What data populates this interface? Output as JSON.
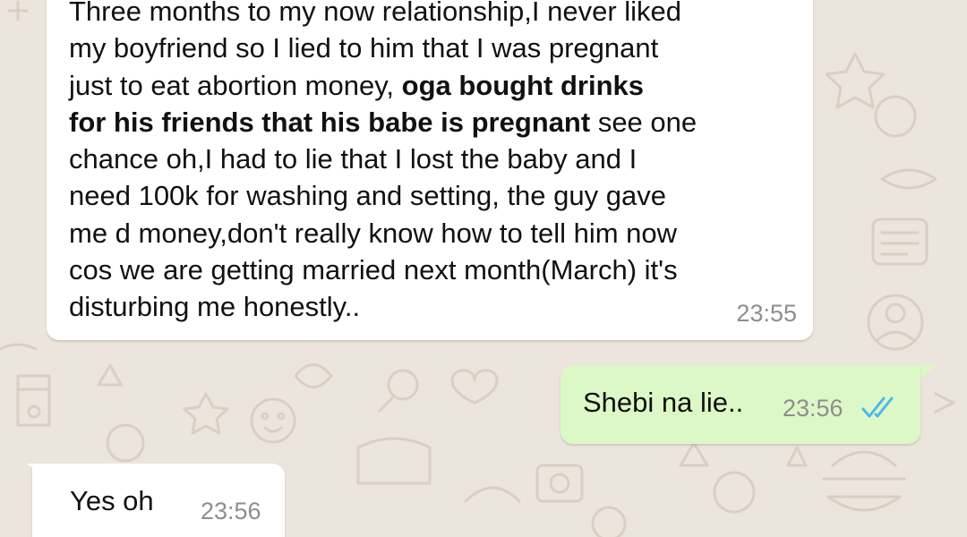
{
  "colors": {
    "wallpaper": "#ece5dd",
    "incoming_bubble": "#ffffff",
    "outgoing_bubble": "#dcf8c6",
    "timestamp": "#8e8e8e",
    "read_ticks": "#4fb6ec"
  },
  "messages": [
    {
      "direction": "incoming",
      "lines": [
        {
          "text": "Three months to my now relationship,I never liked"
        },
        {
          "text": "my boyfriend so I lied to him that I was pregnant"
        },
        {
          "text": "just to eat abortion money, ",
          "bold": "oga bought drinks"
        },
        {
          "bold": "for his friends that his babe is pregnant",
          "text": " see one"
        },
        {
          "text": "chance oh,I had to lie that I lost the baby and I"
        },
        {
          "text": "need 100k for washing and setting, the guy gave"
        },
        {
          "text": "me d money,don't really know how to tell him now"
        },
        {
          "text": "cos we are getting married next month(March) it's"
        },
        {
          "text": "disturbing me honestly.."
        }
      ],
      "time": "23:55"
    },
    {
      "direction": "outgoing",
      "text": "Shebi na lie..",
      "time": "23:56",
      "status_icon": "double-check-read-icon"
    },
    {
      "direction": "incoming",
      "text": "Yes oh",
      "time": "23:56"
    }
  ]
}
